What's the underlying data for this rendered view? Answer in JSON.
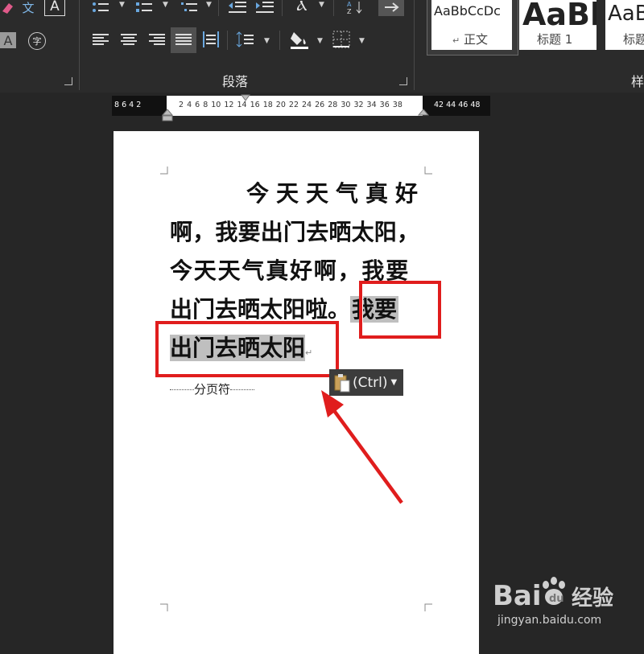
{
  "ribbon": {
    "font_group": {
      "phonetic_label": "文",
      "char_border_label": "A",
      "char_shading_label": "A",
      "enclose_char_label": "字"
    },
    "paragraph_group": {
      "label": "段落"
    },
    "styles_group": {
      "label": "样",
      "items": [
        {
          "sample": "AaBbCcDc",
          "name": "正文",
          "mark": "↵"
        },
        {
          "sample": "AaBb",
          "name": "标题 1"
        },
        {
          "sample": "AaB",
          "name": "标题"
        }
      ]
    }
  },
  "ruler": {
    "left_numbers": "8  6  4  2",
    "middle_numbers": "2  4  6  8 10 12 14 16 18 20 22 24 26 28 30 32 34 36 38",
    "right_numbers": "42 44 46 48"
  },
  "document": {
    "lines": [
      {
        "text": "今天天气真好"
      },
      {
        "text": "啊，我要出门去晒太阳，"
      },
      {
        "text": "今天天气真好啊，我要"
      },
      {
        "text": "出门去晒太阳啦。",
        "highlight": "我要"
      },
      {
        "highlight": "出门去晒太阳",
        "mark": "↵"
      }
    ],
    "page_break_label": "分页符",
    "paste_options_label": "(Ctrl)"
  },
  "colors": {
    "annotation": "#e01d1d",
    "selection": "#bfbfbf",
    "ribbon_bg": "#2b2b2b"
  },
  "watermark": {
    "brand": "Bai",
    "brand_suffix": "经验",
    "url": "jingyan.baidu.com"
  }
}
